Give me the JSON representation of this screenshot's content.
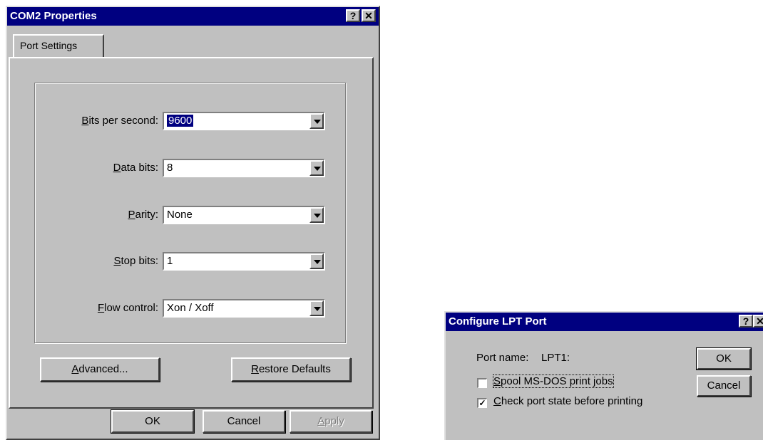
{
  "com2": {
    "title": "COM2 Properties",
    "help_glyph": "?",
    "close_glyph": "✕",
    "tab_label": "Port Settings",
    "fields": [
      {
        "label_ul": "B",
        "label_rest": "its per second:",
        "value": "9600"
      },
      {
        "label_ul": "D",
        "label_rest": "ata bits:",
        "value": "8"
      },
      {
        "label_ul": "P",
        "label_rest": "arity:",
        "value": "None"
      },
      {
        "label_ul": "S",
        "label_rest": "top bits:",
        "value": "1"
      },
      {
        "label_ul": "F",
        "label_rest": "low control:",
        "value": "Xon / Xoff"
      }
    ],
    "advanced_ul": "A",
    "advanced_rest": "dvanced...",
    "restore_ul": "R",
    "restore_rest": "estore Defaults",
    "ok_label": "OK",
    "cancel_label": "Cancel",
    "apply_ul": "A",
    "apply_rest": "pply"
  },
  "lpt": {
    "title": "Configure LPT Port",
    "help_glyph": "?",
    "close_glyph": "✕",
    "port_name_label": "Port name:",
    "port_name_value": "LPT1:",
    "spool_ul": "S",
    "spool_rest": "pool MS-DOS print jobs",
    "spool_checked": false,
    "check_ul": "C",
    "check_rest": "heck port state before printing",
    "check_checked": true,
    "check_mark": "✓",
    "ok_label": "OK",
    "cancel_label": "Cancel"
  }
}
